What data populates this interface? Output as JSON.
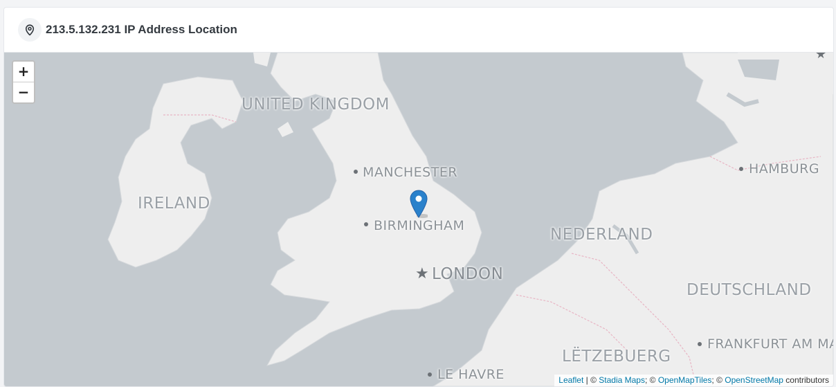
{
  "header": {
    "title": "213.5.132.231 IP Address Location",
    "icon": "map-pin-icon"
  },
  "map": {
    "zoom_in_label": "+",
    "zoom_out_label": "−",
    "marker": {
      "icon": "location-marker-icon",
      "color": "#2a81cb"
    },
    "countries": [
      "UNITED KINGDOM",
      "IRELAND",
      "NEDERLAND",
      "DEUTSCHLAND",
      "LËTZEBUERG"
    ],
    "cities": [
      "MANCHESTER",
      "BIRMINGHAM",
      "HAMBURG",
      "FRANKFURT AM MA",
      "LE HAVRE"
    ],
    "capitals": [
      "LONDON"
    ],
    "colors": {
      "water": "#c4cacf",
      "land": "#eeeeee",
      "border": "#e8b5c4"
    }
  },
  "attribution": {
    "leaflet": "Leaflet",
    "sep1": " | © ",
    "stadia": "Stadia Maps",
    "sep2": "; © ",
    "openmaptiles": "OpenMapTiles",
    "sep3": "; © ",
    "osm": "OpenStreetMap",
    "suffix": " contributors"
  }
}
